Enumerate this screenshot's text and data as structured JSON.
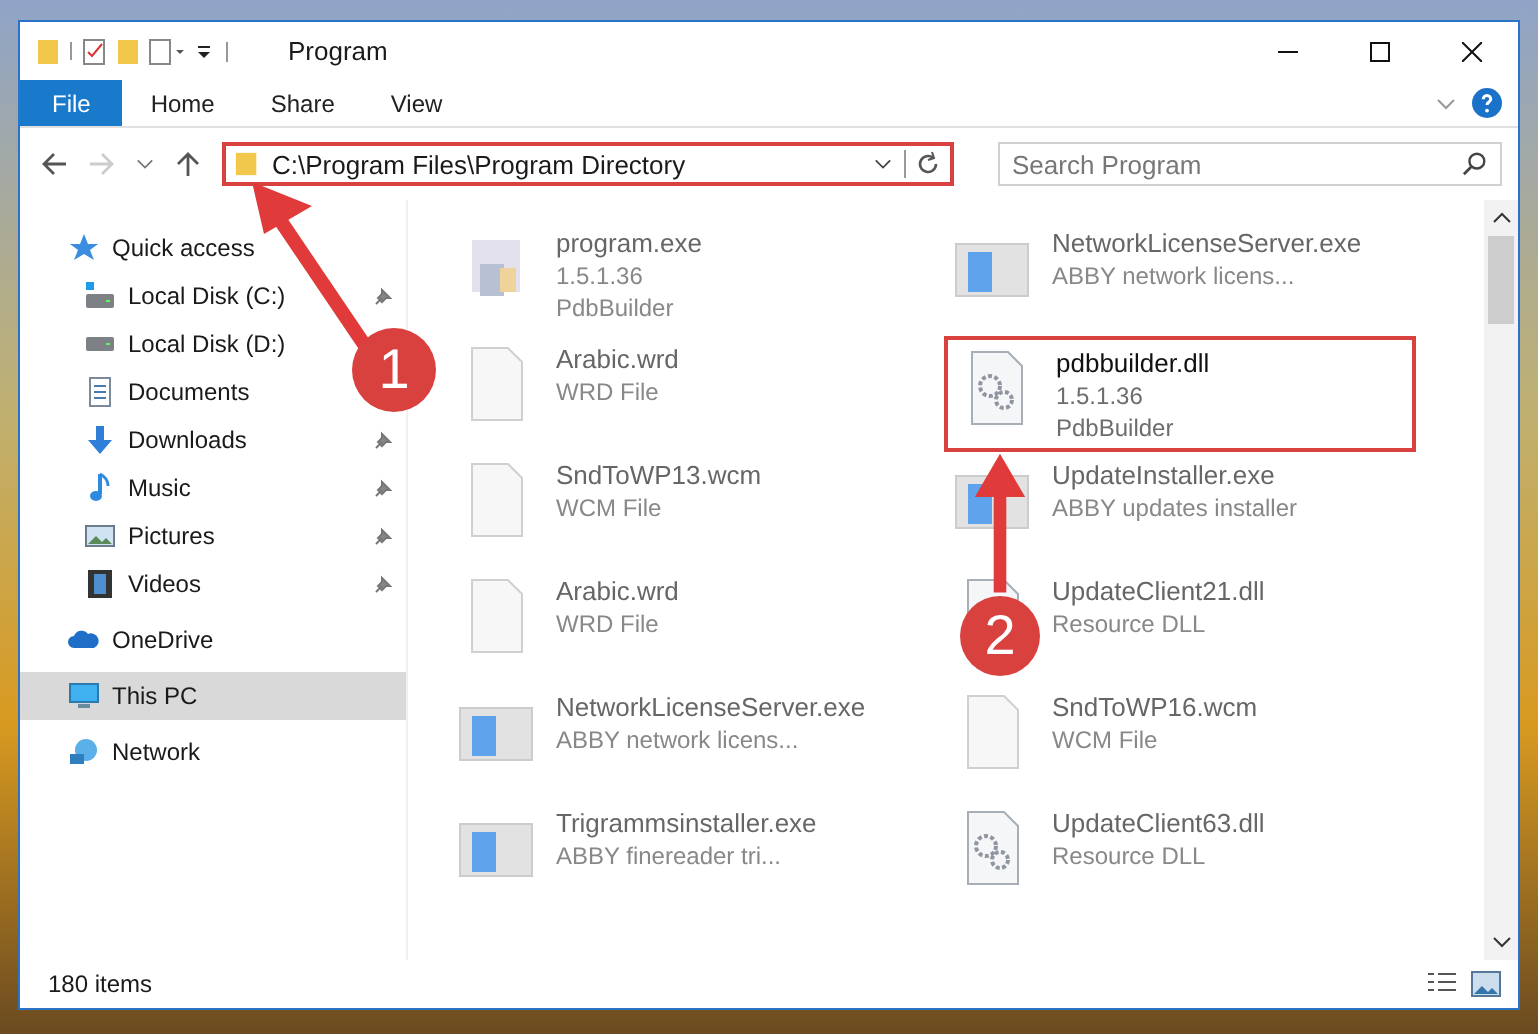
{
  "window": {
    "title": "Program"
  },
  "ribbon_tabs": [
    {
      "label": "File",
      "selected": true
    },
    {
      "label": "Home",
      "selected": false
    },
    {
      "label": "Share",
      "selected": false
    },
    {
      "label": "View",
      "selected": false
    }
  ],
  "address": {
    "path": "C:\\Program Files\\Program Directory",
    "highlighted": true
  },
  "search": {
    "placeholder": "Search Program"
  },
  "sidebar": {
    "items": [
      {
        "label": "Quick access",
        "kind": "star",
        "selected": false,
        "children": [
          {
            "label": "Local Disk (C:)",
            "kind": "disk_c",
            "pinned": true
          },
          {
            "label": "Local Disk (D:)",
            "kind": "disk",
            "pinned": false
          },
          {
            "label": "Documents",
            "kind": "documents",
            "pinned": false
          },
          {
            "label": "Downloads",
            "kind": "downloads",
            "pinned": true
          },
          {
            "label": "Music",
            "kind": "music",
            "pinned": true
          },
          {
            "label": "Pictures",
            "kind": "pictures",
            "pinned": true
          },
          {
            "label": "Videos",
            "kind": "videos",
            "pinned": true
          }
        ]
      },
      {
        "label": "OneDrive",
        "kind": "cloud",
        "selected": false
      },
      {
        "label": "This PC",
        "kind": "pc",
        "selected": true
      },
      {
        "label": "Network",
        "kind": "network",
        "selected": false
      }
    ]
  },
  "files": [
    {
      "name": "program.exe",
      "details": [
        "1.5.1.36",
        "PdbBuilder"
      ],
      "kind": "installer",
      "highlighted": false
    },
    {
      "name": "NetworkLicenseServer.exe",
      "details": [
        "ABBY network licens..."
      ],
      "kind": "app",
      "highlighted": false
    },
    {
      "name": "Arabic.wrd",
      "details": [
        "WRD File"
      ],
      "kind": "doc",
      "highlighted": false
    },
    {
      "name": "pdbbuilder.dll",
      "details": [
        "1.5.1.36",
        "PdbBuilder"
      ],
      "kind": "dll",
      "highlighted": true
    },
    {
      "name": "SndToWP13.wcm",
      "details": [
        "WCM File"
      ],
      "kind": "doc",
      "highlighted": false
    },
    {
      "name": "UpdateInstaller.exe",
      "details": [
        "ABBY updates installer"
      ],
      "kind": "app",
      "highlighted": false
    },
    {
      "name": "Arabic.wrd",
      "details": [
        "WRD File"
      ],
      "kind": "doc",
      "highlighted": false
    },
    {
      "name": "UpdateClient21.dll",
      "details": [
        "Resource DLL"
      ],
      "kind": "dll",
      "highlighted": false
    },
    {
      "name": "NetworkLicenseServer.exe",
      "details": [
        "ABBY network licens..."
      ],
      "kind": "app",
      "highlighted": false
    },
    {
      "name": "SndToWP16.wcm",
      "details": [
        "WCM File"
      ],
      "kind": "doc",
      "highlighted": false
    },
    {
      "name": "Trigrammsinstaller.exe",
      "details": [
        "ABBY finereader tri..."
      ],
      "kind": "app",
      "highlighted": false
    },
    {
      "name": "UpdateClient63.dll",
      "details": [
        "Resource DLL"
      ],
      "kind": "dll",
      "highlighted": false
    }
  ],
  "status_bar": {
    "item_count": "180 items"
  },
  "annotations": [
    {
      "label": "1"
    },
    {
      "label": "2"
    }
  ]
}
